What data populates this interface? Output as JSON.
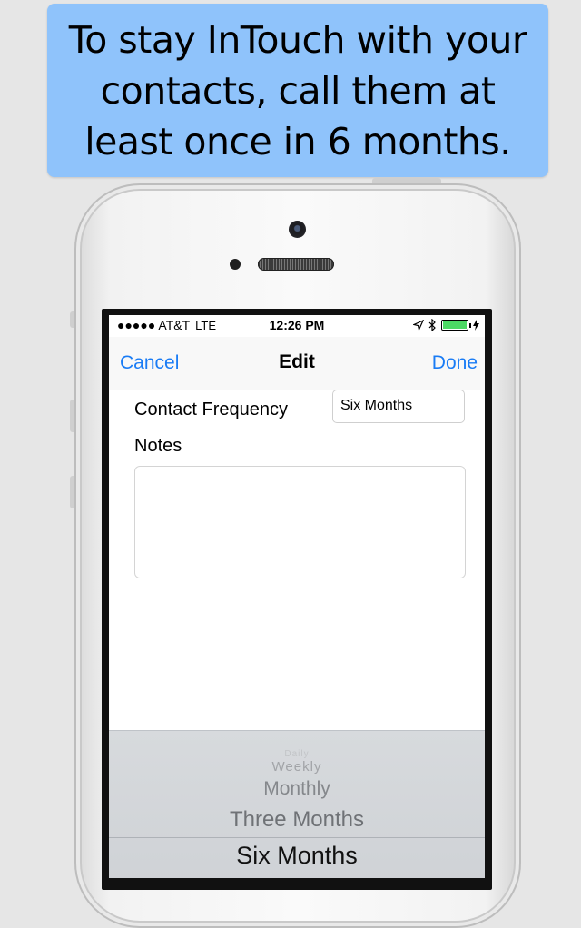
{
  "banner": {
    "text": "To stay InTouch with your contacts, call them at least once in 6 months."
  },
  "status_bar": {
    "carrier": "●●●●● AT&T",
    "network": "LTE",
    "time": "12:26 PM"
  },
  "nav": {
    "cancel_label": "Cancel",
    "title": "Edit",
    "done_label": "Done"
  },
  "form": {
    "frequency_label": "Contact Frequency",
    "frequency_value": "Six Months",
    "notes_label": "Notes",
    "notes_value": ""
  },
  "picker": {
    "options": [
      "Daily",
      "Weekly",
      "Monthly",
      "Three Months",
      "Six Months"
    ],
    "selected": "Six Months"
  },
  "colors": {
    "accent": "#1a7cf5",
    "banner": "#8fc3fb",
    "battery": "#4cd964"
  },
  "icons": [
    "location-arrow-icon",
    "bluetooth-icon",
    "battery-icon",
    "charging-bolt-icon"
  ]
}
